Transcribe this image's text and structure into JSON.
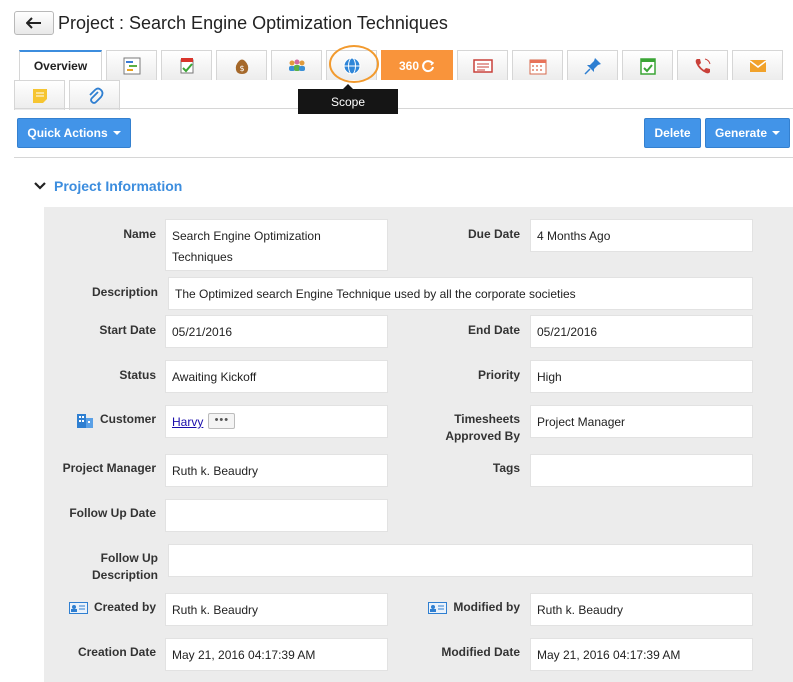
{
  "header": {
    "title": "Project : Search Engine Optimization Techniques"
  },
  "tabs": {
    "overview_label": "Overview",
    "t360_label": "360",
    "tooltip": "Scope",
    "icons": [
      "gantt-icon",
      "milestone-icon",
      "budget-icon",
      "team-icon",
      "scope-icon",
      "cases-icon",
      "calendar-icon",
      "pin-icon",
      "task-icon",
      "call-icon",
      "email-icon",
      "note-icon",
      "attachment-icon"
    ]
  },
  "toolbar": {
    "quick_actions": "Quick Actions",
    "delete": "Delete",
    "generate": "Generate"
  },
  "section": {
    "title": "Project Information"
  },
  "fields": {
    "name_label": "Name",
    "name_value": "Search Engine Optimization Techniques",
    "due_date_label": "Due Date",
    "due_date_value": "4 Months Ago",
    "description_label": "Description",
    "description_value": "The Optimized search Engine Technique used by all the corporate societies",
    "start_date_label": "Start Date",
    "start_date_value": "05/21/2016",
    "end_date_label": "End Date",
    "end_date_value": "05/21/2016",
    "status_label": "Status",
    "status_value": "Awaiting Kickoff",
    "priority_label": "Priority",
    "priority_value": "High",
    "customer_label": "Customer",
    "customer_value": "Harvy",
    "customer_more": "•••",
    "timesheets_label": "Timesheets Approved By",
    "timesheets_value": "Project Manager",
    "project_manager_label": "Project Manager",
    "project_manager_value": "Ruth k. Beaudry",
    "tags_label": "Tags",
    "tags_value": "",
    "follow_up_date_label": "Follow Up Date",
    "follow_up_date_value": "",
    "follow_up_desc_label": "Follow Up Description",
    "follow_up_desc_value": "",
    "created_by_label": "Created by",
    "created_by_value": "Ruth k. Beaudry",
    "modified_by_label": "Modified by",
    "modified_by_value": "Ruth k. Beaudry",
    "creation_date_label": "Creation Date",
    "creation_date_value": "May 21, 2016 04:17:39 AM",
    "modified_date_label": "Modified Date",
    "modified_date_value": "May 21, 2016 04:17:39 AM"
  },
  "colors": {
    "accent": "#3c8dde",
    "button": "#4294e8",
    "tab360": "#f9943b",
    "highlight": "#f29a2e"
  }
}
